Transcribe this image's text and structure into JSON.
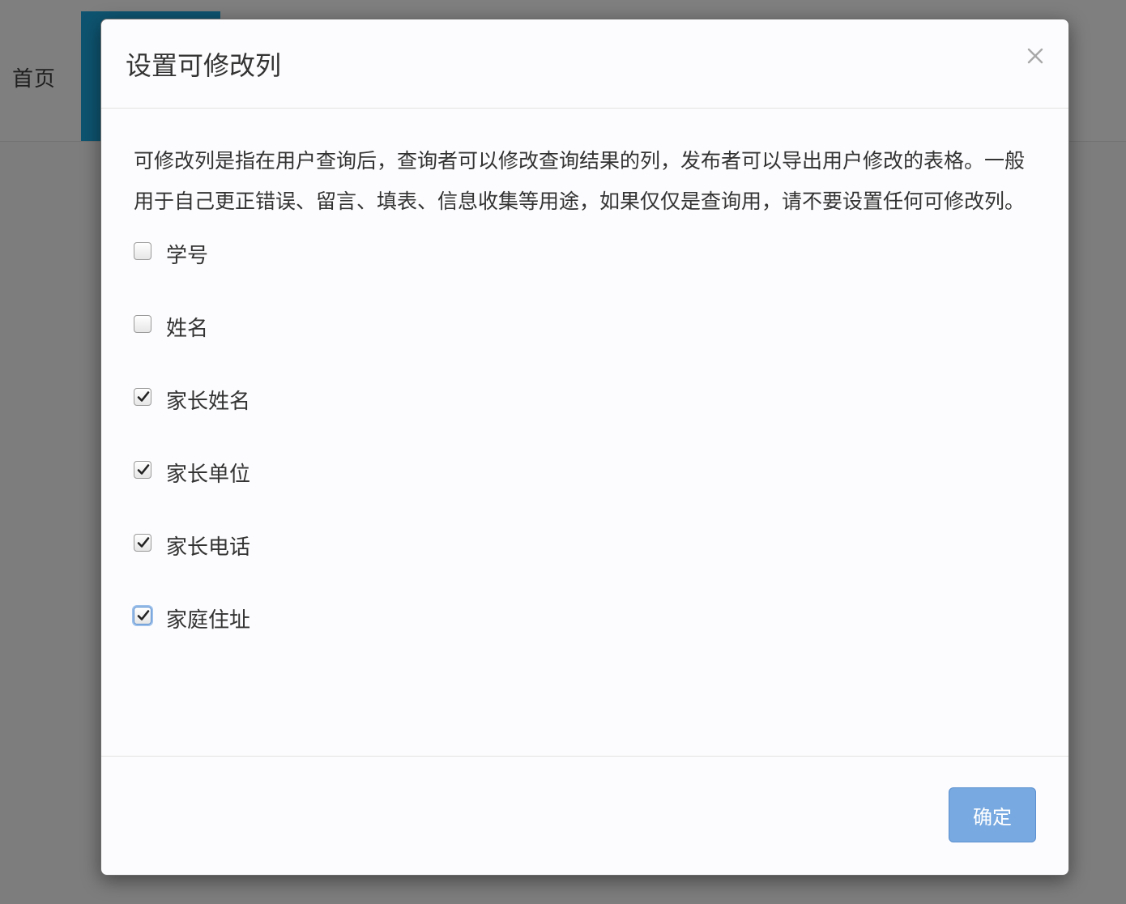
{
  "background": {
    "nav_home_label": "首页"
  },
  "modal": {
    "title": "设置可修改列",
    "close_icon": "close-icon",
    "description": "可修改列是指在用户查询后，查询者可以修改查询结果的列，发布者可以导出用户修改的表格。一般用于自己更正错误、留言、填表、信息收集等用途，如果仅仅是查询用，请不要设置任何可修改列。",
    "options": [
      {
        "label": "学号",
        "checked": false
      },
      {
        "label": "姓名",
        "checked": false
      },
      {
        "label": "家长姓名",
        "checked": true
      },
      {
        "label": "家长单位",
        "checked": true
      },
      {
        "label": "家长电话",
        "checked": true
      },
      {
        "label": "家庭住址",
        "checked": true,
        "focused": true
      }
    ],
    "confirm_label": "确定"
  },
  "colors": {
    "overlay": "#7d7d7d",
    "active_tab": "#0e5470",
    "primary_button": "#78a9e0",
    "text": "#333333"
  }
}
